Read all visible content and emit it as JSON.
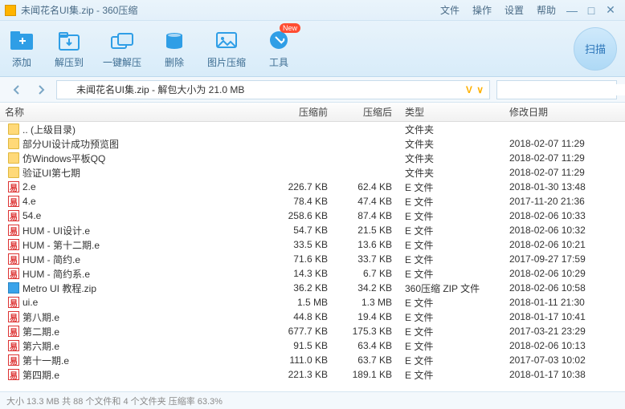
{
  "title": "未闻花名UI集.zip - 360压缩",
  "menu": {
    "file": "文件",
    "operate": "操作",
    "settings": "设置",
    "help": "帮助"
  },
  "toolbar": {
    "add": "添加",
    "extract": "解压到",
    "oneclick": "一键解压",
    "delete": "删除",
    "imgcompress": "图片压缩",
    "tools": "工具",
    "new_badge": "New",
    "scan": "扫描"
  },
  "path": {
    "label": "未闻花名UI集.zip - 解包大小为 21.0 MB",
    "vip": "V ∨"
  },
  "search": {
    "placeholder": ""
  },
  "columns": {
    "name": "名称",
    "before": "压缩前",
    "after": "压缩后",
    "type": "类型",
    "date": "修改日期"
  },
  "rows": [
    {
      "icon": "folder",
      "name": ".. (上级目录)",
      "before": "",
      "after": "",
      "type": "文件夹",
      "date": ""
    },
    {
      "icon": "folder",
      "name": "部分UI设计成功预览图",
      "before": "",
      "after": "",
      "type": "文件夹",
      "date": "2018-02-07 11:29"
    },
    {
      "icon": "folder",
      "name": "仿Windows平板QQ",
      "before": "",
      "after": "",
      "type": "文件夹",
      "date": "2018-02-07 11:29"
    },
    {
      "icon": "folder",
      "name": "验证UI第七期",
      "before": "",
      "after": "",
      "type": "文件夹",
      "date": "2018-02-07 11:29"
    },
    {
      "icon": "e",
      "name": "2.e",
      "before": "226.7 KB",
      "after": "62.4 KB",
      "type": "E 文件",
      "date": "2018-01-30 13:48"
    },
    {
      "icon": "e",
      "name": "4.e",
      "before": "78.4 KB",
      "after": "47.4 KB",
      "type": "E 文件",
      "date": "2017-11-20 21:36"
    },
    {
      "icon": "e",
      "name": "54.e",
      "before": "258.6 KB",
      "after": "87.4 KB",
      "type": "E 文件",
      "date": "2018-02-06 10:33"
    },
    {
      "icon": "e",
      "name": "HUM - UI设计.e",
      "before": "54.7 KB",
      "after": "21.5 KB",
      "type": "E 文件",
      "date": "2018-02-06 10:32"
    },
    {
      "icon": "e",
      "name": "HUM - 第十二期.e",
      "before": "33.5 KB",
      "after": "13.6 KB",
      "type": "E 文件",
      "date": "2018-02-06 10:21"
    },
    {
      "icon": "e",
      "name": "HUM - 简约.e",
      "before": "71.6 KB",
      "after": "33.7 KB",
      "type": "E 文件",
      "date": "2017-09-27 17:59"
    },
    {
      "icon": "e",
      "name": "HUM - 简约系.e",
      "before": "14.3 KB",
      "after": "6.7 KB",
      "type": "E 文件",
      "date": "2018-02-06 10:29"
    },
    {
      "icon": "zip",
      "name": "Metro UI 教程.zip",
      "before": "36.2 KB",
      "after": "34.2 KB",
      "type": "360压缩 ZIP 文件",
      "date": "2018-02-06 10:58"
    },
    {
      "icon": "e",
      "name": "ui.e",
      "before": "1.5 MB",
      "after": "1.3 MB",
      "type": "E 文件",
      "date": "2018-01-11 21:30"
    },
    {
      "icon": "e",
      "name": "第八期.e",
      "before": "44.8 KB",
      "after": "19.4 KB",
      "type": "E 文件",
      "date": "2018-01-17 10:41"
    },
    {
      "icon": "e",
      "name": "第二期.e",
      "before": "677.7 KB",
      "after": "175.3 KB",
      "type": "E 文件",
      "date": "2017-03-21 23:29"
    },
    {
      "icon": "e",
      "name": "第六期.e",
      "before": "91.5 KB",
      "after": "63.4 KB",
      "type": "E 文件",
      "date": "2018-02-06 10:13"
    },
    {
      "icon": "e",
      "name": "第十一期.e",
      "before": "111.0 KB",
      "after": "63.7 KB",
      "type": "E 文件",
      "date": "2017-07-03 10:02"
    },
    {
      "icon": "e",
      "name": "第四期.e",
      "before": "221.3 KB",
      "after": "189.1 KB",
      "type": "E 文件",
      "date": "2018-01-17 10:38"
    }
  ],
  "status": "大小 13.3 MB 共 88 个文件和 4 个文件夹 压缩率 63.3%"
}
